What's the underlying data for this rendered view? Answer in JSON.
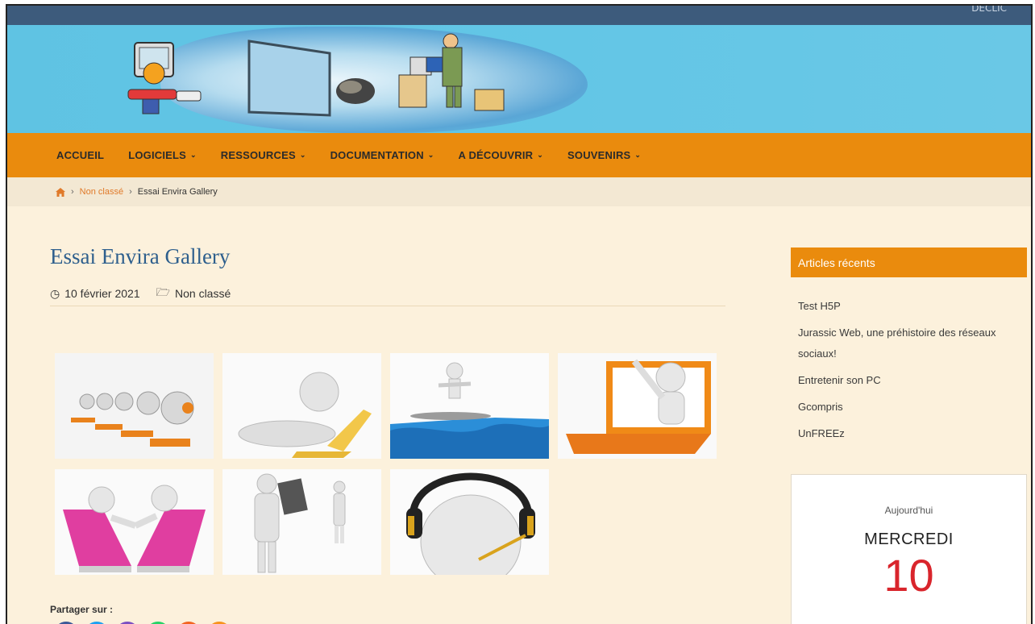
{
  "topbar": {
    "right_text": "DÉCLIC"
  },
  "nav": {
    "items": [
      {
        "label": "ACCUEIL",
        "has_menu": false
      },
      {
        "label": "LOGICIELS",
        "has_menu": true
      },
      {
        "label": "RESSOURCES",
        "has_menu": true
      },
      {
        "label": "DOCUMENTATION",
        "has_menu": true
      },
      {
        "label": "A DÉCOUVRIR",
        "has_menu": true
      },
      {
        "label": "SOUVENIRS",
        "has_menu": true
      }
    ]
  },
  "breadcrumb": {
    "category": "Non classé",
    "current": "Essai Envira Gallery",
    "separator": "›"
  },
  "post": {
    "title": "Essai Envira Gallery",
    "date": "10 février 2021",
    "category": "Non classé",
    "gallery": [
      {
        "icon": "headset-team-icon"
      },
      {
        "icon": "person-laptop-icon"
      },
      {
        "icon": "surfer-icon"
      },
      {
        "icon": "laptop-wave-icon"
      },
      {
        "icon": "handshake-laptops-icon"
      },
      {
        "icon": "tablet-figures-icon"
      },
      {
        "icon": "headphones-figure-icon"
      }
    ],
    "share_label": "Partager sur :"
  },
  "sidebar": {
    "recent_title": "Articles récents",
    "recent_items": [
      "Test H5P",
      "Jurassic Web, une préhistoire des réseaux sociaux!",
      "Entretenir son PC",
      "Gcompris",
      "UnFREEz"
    ],
    "calendar": {
      "label": "Aujourd'hui",
      "weekday": "MERCREDI",
      "day": "10"
    }
  },
  "colors": {
    "nav": "#ea8b0d",
    "topbar": "#3d5b7c",
    "title": "#2e5f8d",
    "accent_red": "#d9252c"
  }
}
